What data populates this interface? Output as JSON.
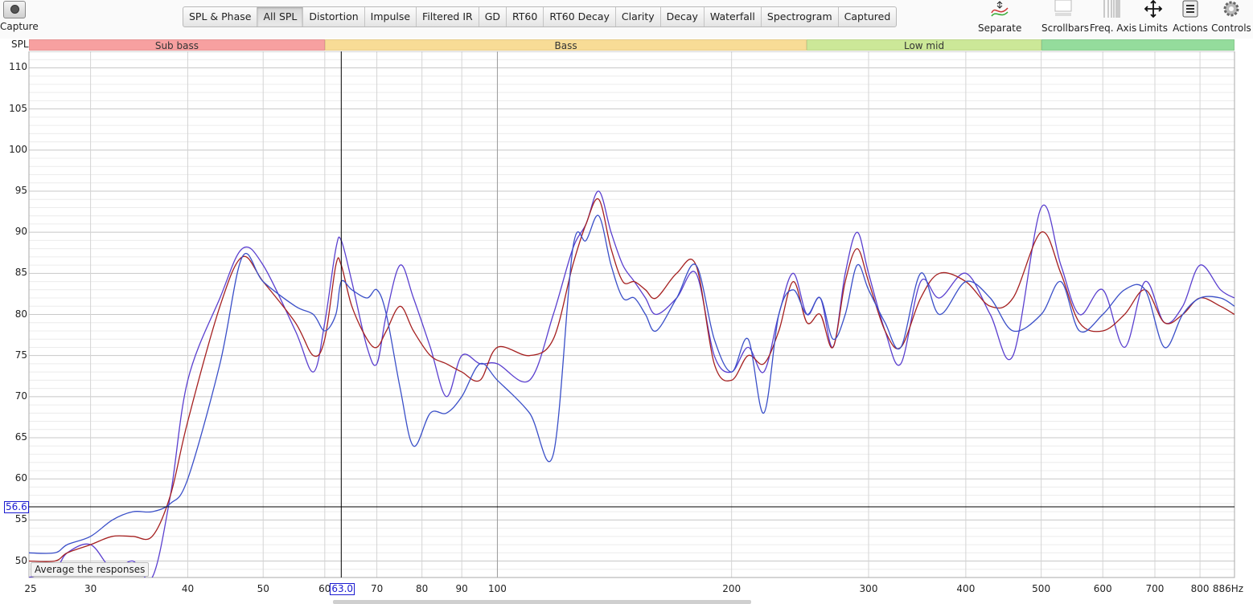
{
  "toolbar": {
    "capture_label": "Capture",
    "tabs": [
      "SPL & Phase",
      "All SPL",
      "Distortion",
      "Impulse",
      "Filtered IR",
      "GD",
      "RT60",
      "RT60 Decay",
      "Clarity",
      "Decay",
      "Waterfall",
      "Spectrogram",
      "Captured"
    ],
    "active_tab": "All SPL",
    "tools": [
      {
        "label": "Separate",
        "icon": "separate-icon"
      },
      {
        "label": "Scrollbars",
        "icon": "scrollbars-icon"
      },
      {
        "label": "Freq. Axis",
        "icon": "freq-axis-icon"
      },
      {
        "label": "Limits",
        "icon": "limits-icon"
      },
      {
        "label": "Actions",
        "icon": "actions-icon"
      },
      {
        "label": "Controls",
        "icon": "controls-icon"
      }
    ]
  },
  "bands": [
    {
      "label": "Sub bass",
      "from": 25,
      "to": 60,
      "color": "#f7a0a0"
    },
    {
      "label": "Bass",
      "from": 60,
      "to": 250,
      "color": "#f8dc96"
    },
    {
      "label": "Low mid",
      "from": 250,
      "to": 500,
      "color": "#cce898"
    },
    {
      "label": "",
      "from": 500,
      "to": 886,
      "color": "#94dc9c"
    }
  ],
  "cursor": {
    "y_value": "56.6",
    "x_value": "63.0",
    "x": 63.0,
    "y": 56.6
  },
  "avg_button": "Average the responses",
  "chart_data": {
    "type": "line",
    "title": "",
    "ylabel": "SPL",
    "xlabel": "Hz",
    "x_scale": "log",
    "xlim": [
      25,
      886
    ],
    "ylim": [
      48,
      112
    ],
    "grid": true,
    "y_ticks": [
      "50",
      "55",
      "60",
      "65",
      "70",
      "75",
      "80",
      "85",
      "90",
      "95",
      "100",
      "105",
      "110"
    ],
    "x_ticks": [
      "25",
      "30",
      "40",
      "50",
      "60",
      "70",
      "80",
      "90",
      "100",
      "200",
      "300",
      "400",
      "500",
      "600",
      "700",
      "800",
      "886Hz"
    ],
    "series": [
      {
        "color": "#5a3fcf",
        "x": [
          25,
          27,
          28,
          30,
          32,
          34,
          36,
          38,
          40,
          44,
          47,
          50,
          55,
          58,
          60,
          62,
          63,
          65,
          68,
          70,
          72,
          75,
          78,
          82,
          86,
          90,
          95,
          100,
          110,
          118,
          125,
          130,
          135,
          140,
          145,
          150,
          155,
          160,
          170,
          180,
          190,
          200,
          210,
          220,
          230,
          240,
          250,
          260,
          270,
          280,
          290,
          300,
          315,
          330,
          350,
          370,
          400,
          430,
          460,
          500,
          530,
          560,
          600,
          640,
          680,
          720,
          760,
          800,
          850,
          886
        ],
        "y": [
          48,
          49,
          51,
          52,
          49,
          50,
          48,
          58,
          72,
          82,
          88,
          86,
          78,
          73,
          79,
          88,
          89,
          84,
          76,
          74,
          80,
          86,
          82,
          76,
          70,
          75,
          74,
          74,
          72,
          80,
          88,
          91,
          95,
          90,
          86,
          84,
          82,
          80,
          82,
          85,
          75,
          73,
          76,
          73,
          80,
          85,
          80,
          82,
          76,
          85,
          90,
          85,
          78,
          74,
          84,
          82,
          85,
          80,
          75,
          93,
          86,
          80,
          83,
          76,
          84,
          79,
          81,
          86,
          83,
          82
        ]
      },
      {
        "color": "#a52020",
        "x": [
          25,
          27,
          28,
          30,
          32,
          34,
          36,
          38,
          40,
          44,
          47,
          50,
          55,
          58,
          60,
          62,
          63,
          65,
          68,
          70,
          72,
          75,
          78,
          82,
          86,
          90,
          95,
          100,
          110,
          118,
          125,
          130,
          135,
          140,
          145,
          150,
          155,
          160,
          170,
          180,
          190,
          200,
          210,
          220,
          230,
          240,
          250,
          260,
          270,
          280,
          290,
          300,
          315,
          330,
          350,
          370,
          400,
          430,
          460,
          500,
          530,
          560,
          600,
          640,
          680,
          720,
          760,
          800,
          850,
          886
        ],
        "y": [
          50,
          50,
          51,
          52,
          53,
          53,
          53,
          58,
          67,
          81,
          87,
          84,
          79,
          75,
          77,
          86,
          86,
          81,
          77,
          76,
          78,
          81,
          78,
          75,
          74,
          73,
          72,
          76,
          75,
          77,
          86,
          91,
          94,
          88,
          84,
          84,
          83,
          82,
          85,
          86,
          74,
          72,
          75,
          74,
          78,
          84,
          79,
          80,
          76,
          84,
          88,
          84,
          78,
          76,
          82,
          85,
          84,
          81,
          82,
          90,
          85,
          79,
          78,
          80,
          83,
          79,
          80,
          82,
          81,
          80
        ]
      },
      {
        "color": "#3a4fc8",
        "x": [
          25,
          27,
          28,
          30,
          32,
          34,
          36,
          38,
          40,
          44,
          47,
          50,
          55,
          58,
          60,
          62,
          63,
          65,
          68,
          70,
          72,
          75,
          78,
          82,
          86,
          90,
          95,
          100,
          110,
          118,
          125,
          130,
          135,
          140,
          145,
          150,
          155,
          160,
          170,
          180,
          190,
          200,
          210,
          220,
          230,
          240,
          250,
          260,
          270,
          280,
          290,
          300,
          315,
          330,
          350,
          370,
          400,
          430,
          460,
          500,
          530,
          560,
          600,
          640,
          680,
          720,
          760,
          800,
          850,
          886
        ],
        "y": [
          51,
          51,
          52,
          53,
          55,
          56,
          56,
          57,
          60,
          74,
          87,
          84,
          81,
          80,
          78,
          80,
          84,
          83,
          82,
          83,
          80,
          71,
          64,
          68,
          68,
          70,
          74,
          72,
          68,
          63,
          88,
          89,
          92,
          86,
          82,
          82,
          80,
          78,
          82,
          86,
          77,
          73,
          77,
          68,
          80,
          83,
          80,
          82,
          77,
          80,
          86,
          83,
          79,
          76,
          85,
          80,
          84,
          82,
          78,
          80,
          84,
          78,
          80,
          83,
          83,
          76,
          80,
          82,
          82,
          81
        ]
      }
    ]
  }
}
